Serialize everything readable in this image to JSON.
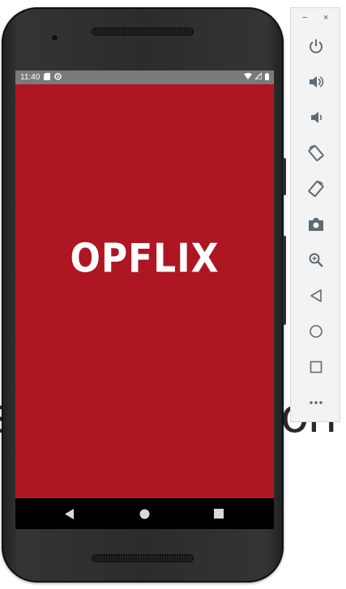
{
  "status_bar": {
    "time": "11:40"
  },
  "app": {
    "name": "OPFLIX",
    "background_color": "#ae1622"
  },
  "nav_bar": {
    "buttons": [
      "back",
      "home",
      "recents"
    ]
  },
  "toolbar": {
    "window_controls": {
      "minimize": "−",
      "close": "×"
    },
    "buttons": [
      "power-icon",
      "volume-up-icon",
      "volume-down-icon",
      "rotate-left-icon",
      "rotate-right-icon",
      "camera-icon",
      "zoom-icon",
      "back-icon",
      "home-icon",
      "overview-icon",
      "more-icon"
    ],
    "more_label": "•••"
  },
  "background_text": {
    "left": "s",
    "right": "on"
  }
}
